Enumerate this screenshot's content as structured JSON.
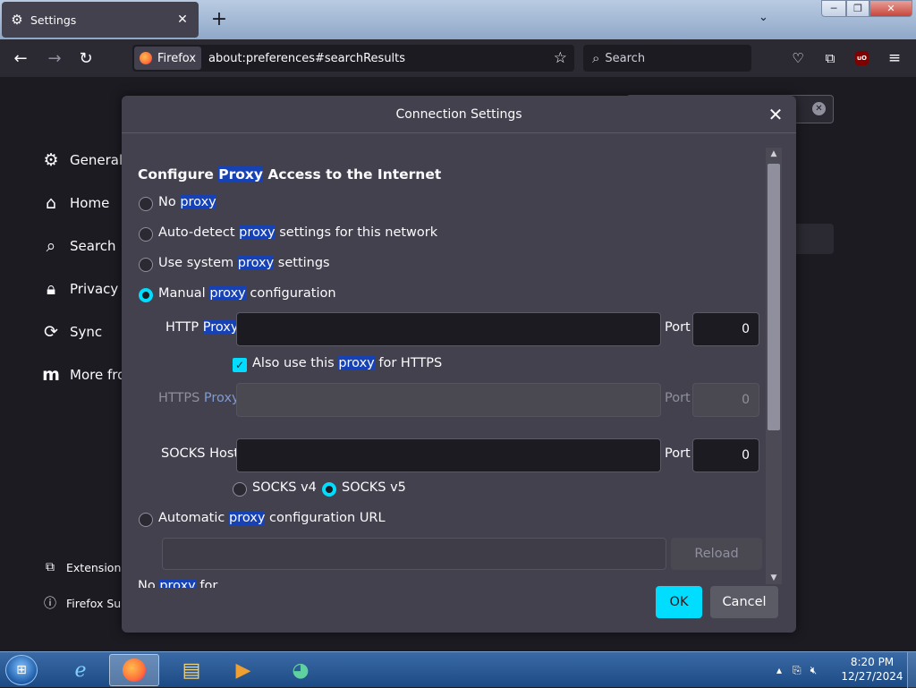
{
  "tab": {
    "title": "Settings",
    "icon": "gear-icon"
  },
  "navbar": {
    "identity_label": "Firefox",
    "url": "about:preferences#searchResults",
    "search_placeholder": "Search"
  },
  "sidebar": {
    "items": [
      {
        "label": "General",
        "icon": "gear-icon"
      },
      {
        "label": "Home",
        "icon": "home-icon"
      },
      {
        "label": "Search",
        "icon": "search-icon"
      },
      {
        "label": "Privacy &",
        "icon": "lock-icon"
      },
      {
        "label": "Sync",
        "icon": "sync-icon"
      },
      {
        "label": "More fro",
        "icon": "mozilla-icon"
      }
    ],
    "footer": [
      {
        "label": "Extension",
        "icon": "puzzle-icon"
      },
      {
        "label": "Firefox Su",
        "icon": "help-icon"
      }
    ]
  },
  "dialog": {
    "title": "Connection Settings",
    "heading": {
      "pre": "Configure ",
      "hl": "Proxy",
      "post": " Access to the Internet"
    },
    "options": {
      "no_proxy": {
        "pre": "No ",
        "hl": "proxy",
        "post": ""
      },
      "auto_detect": {
        "pre": "Auto-detect ",
        "hl": "proxy",
        "post": " settings for this network"
      },
      "system": {
        "pre": "Use system ",
        "hl": "proxy",
        "post": " settings"
      },
      "manual": {
        "pre": "Manual ",
        "hl": "proxy",
        "post": " configuration",
        "selected": true
      },
      "auto_url": {
        "pre": "Automatic ",
        "hl": "proxy",
        "post": " configuration URL"
      }
    },
    "http": {
      "pre": "HTTP ",
      "hl": "Proxy",
      "value": "",
      "port_label": "Port",
      "port": "0"
    },
    "also_https": {
      "pre": "Also use this ",
      "hl": "proxy",
      "post": " for HTTPS",
      "checked": true
    },
    "https": {
      "pre": "HTTPS ",
      "hl": "Proxy",
      "value": "",
      "port_label": "Port",
      "port": "0"
    },
    "socks": {
      "label": "SOCKS Host",
      "value": "",
      "port_label": "Port",
      "port": "0",
      "v4": "SOCKS v4",
      "v5": "SOCKS v5",
      "selected": "v5"
    },
    "reload_label": "Reload",
    "cutoff": {
      "pre": "No ",
      "hl": "proxy",
      "post": " for"
    },
    "ok_label": "OK",
    "cancel_label": "Cancel"
  },
  "clock": {
    "time": "8:20 PM",
    "date": "12/27/2024"
  },
  "colors": {
    "accent": "#00ddff",
    "highlight": "#1642b6",
    "dialog_bg": "#42414d"
  }
}
